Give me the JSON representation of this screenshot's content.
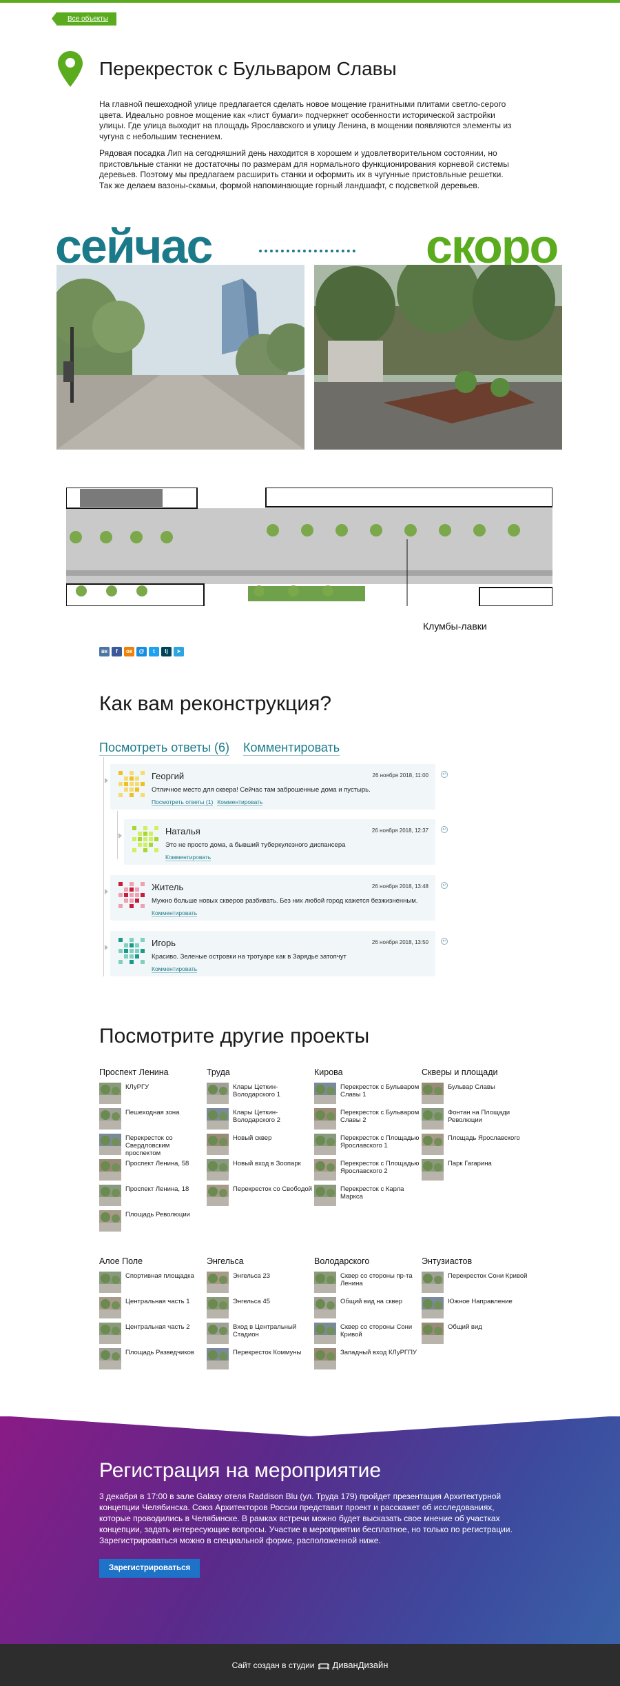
{
  "nav": {
    "back_label": "Все объекты"
  },
  "page": {
    "title": "Перекресток с Бульваром Славы",
    "paragraphs": [
      "На главной пешеходной улице предлагается сделать новое мощение гранитными плитами светло-серого цвета. Идеально ровное мощение как «лист бумаги» подчеркнет особенности исторической застройки улицы. Где улица выходит на площадь Ярославского и улицу Ленина, в мощении появляются элементы из чугуна с небольшим теснением.",
      "Рядовая посадка Лип на сегодняшний день находится в хорошем и удовлетворительном состоянии, но пристовльные станки не достаточны по размерам для нормального функционирования корневой системы деревьев. Поэтому мы предлагаем расширить станки и оформить их в чугунные пристовльные решетки. Так же делаем вазоны-скамьи, формой напоминающие горный ландшафт, с подсветкой деревьев."
    ]
  },
  "compare": {
    "now": "сейчас",
    "soon": "скоро"
  },
  "plan": {
    "label": "Клумбы-лавки"
  },
  "share": [
    {
      "icon": "vk-icon",
      "glyph": "вк",
      "color": "#4c75a3"
    },
    {
      "icon": "facebook-icon",
      "glyph": "f",
      "color": "#3b5998"
    },
    {
      "icon": "odnoklassniki-icon",
      "glyph": "ок",
      "color": "#ee8208"
    },
    {
      "icon": "moimir-icon",
      "glyph": "@",
      "color": "#168de2"
    },
    {
      "icon": "twitter-icon",
      "glyph": "t",
      "color": "#1da1f2"
    },
    {
      "icon": "livejournal-icon",
      "glyph": "lj",
      "color": "#004359"
    },
    {
      "icon": "telegram-icon",
      "glyph": "➤",
      "color": "#2ca5e0"
    }
  ],
  "comments": {
    "question": "Как вам реконструкция?",
    "tab_answers": "Посмотреть ответы (6)",
    "tab_comment": "Комментировать",
    "items": [
      {
        "author": "Георгий",
        "date": "26 ноября 2018, 11:00",
        "text": "Отличное место для сквера! Сейчас там заброшенные дома и пустырь.",
        "link_answers": "Посмотреть ответы (1)",
        "link_comment": "Комментировать"
      },
      {
        "author": "Наталья",
        "date": "26 ноября 2018, 12:37",
        "text": "Это не просто дома, а бывший туберкулезного диспансера",
        "link_comment": "Комментировать"
      },
      {
        "author": "Житель",
        "date": "26 ноября 2018, 13:48",
        "text": "Мужно больше новых скверов разбивать. Без них любой город кажется безжизненным.",
        "link_comment": "Комментировать"
      },
      {
        "author": "Игорь",
        "date": "26 ноября 2018, 13:50",
        "text": "Красиво. Зеленые островки на тротуаре как в Зарядье затопчут",
        "link_comment": "Комментировать"
      }
    ]
  },
  "projects": {
    "title": "Посмотрите другие проекты",
    "columns": [
      {
        "heading": "Проспект Ленина",
        "items": [
          "КЛуРГУ",
          "Пешеходная зона",
          "Перекресток со Свердловским проспектом",
          "Проспект Ленина, 58",
          "Проспект Ленина, 18",
          "Площадь Революции"
        ]
      },
      {
        "heading": "Труда",
        "items": [
          "Клары Цеткин-Володарского 1",
          "Клары Цеткин-Володарского 2",
          "Новый сквер",
          "Новый вход в Зоопарк",
          "Перекресток со Свободой"
        ]
      },
      {
        "heading": "Кирова",
        "items": [
          "Перекресток с Бульваром Славы 1",
          "Перекресток с Бульваром Славы 2",
          "Перекресток с Площадью Ярославского 1",
          "Перекресток с Площадью Ярославского 2",
          "Перекресток с Карла Маркса"
        ]
      },
      {
        "heading": "Скверы и площади",
        "items": [
          "Бульвар Славы",
          "Фонтан на Площади Революции",
          "Площадь Ярославского",
          "Парк Гагарина"
        ]
      },
      {
        "heading": "Алое Поле",
        "items": [
          "Спортивная площадка",
          "Центральная часть 1",
          "Центральная часть 2",
          "Площадь Разведчиков"
        ]
      },
      {
        "heading": "Энгельса",
        "items": [
          "Энгельса 23",
          "Энгельса 45",
          "Вход в Центральный Стадион",
          "Перекресток Коммуны"
        ]
      },
      {
        "heading": "Володарского",
        "items": [
          "Сквер со стороны пр-та Ленина",
          "Общий вид на сквер",
          "Сквер со стороны Сони Кривой",
          "Западный вход КЛуРГПУ"
        ]
      },
      {
        "heading": "Энтузиастов",
        "items": [
          "Перекресток Сони Кривой",
          "Южное Направление",
          "Общий вид"
        ]
      }
    ]
  },
  "registration": {
    "title": "Регистрация на мероприятие",
    "text": "3 декабря в 17:00 в зале Galaxy отеля Raddison Blu (ул. Труда 179) пройдет презентация Архитектурной концепции Челябинска. Союз Архитекторов России представит проект и расскажет об исследованиях, которые проводились в Челябинске. В рамках встречи можно будет высказать свое мнение об участках концепции, задать интересующие вопросы. Участие в мероприятии бесплатное, но только по регистрации. Зарегистрироваться можно в специальной форме, расположенной ниже.",
    "button": "Зарегистрироваться"
  },
  "footer": {
    "text": "Сайт создан в студии",
    "brand": "ДиванДизайн"
  }
}
